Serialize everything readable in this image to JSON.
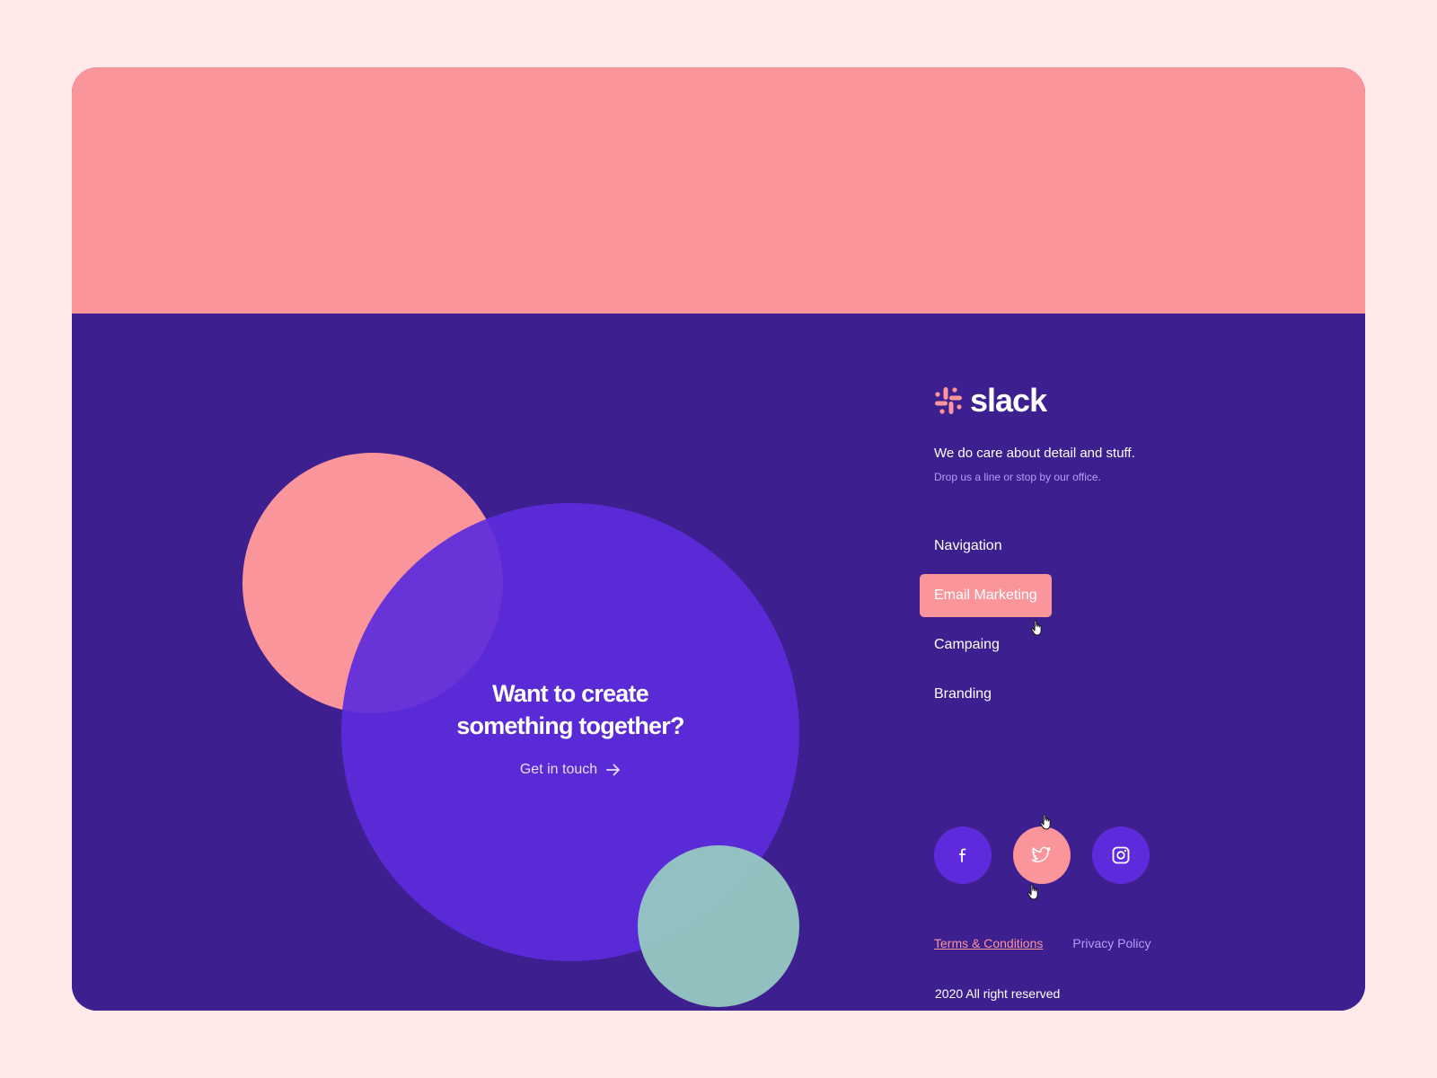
{
  "brand": {
    "name": "slack",
    "logo_color": "#fa959b"
  },
  "colors": {
    "page_bg": "#ffe9e9",
    "banner": "#fa959b",
    "footer_bg": "#3d1f8f",
    "accent_purple": "#5d2bdc",
    "accent_pink": "#fa959b",
    "accent_teal": "#98ccc2",
    "muted_text": "#b79cf4"
  },
  "cta": {
    "title_line1": "Want to create",
    "title_line2": "something together?",
    "link_label": "Get in touch",
    "link_icon": "arrow-right-icon"
  },
  "info": {
    "tagline": "We do care about detail and stuff.",
    "subline": "Drop us a line or stop by our office."
  },
  "nav": {
    "items": [
      {
        "label": "Navigation",
        "active": false
      },
      {
        "label": "Email Marketing",
        "active": true
      },
      {
        "label": "Campaing",
        "active": false
      },
      {
        "label": "Branding",
        "active": false
      }
    ]
  },
  "social": {
    "items": [
      {
        "icon": "facebook-icon",
        "active": false
      },
      {
        "icon": "twitter-icon",
        "active": true
      },
      {
        "icon": "instagram-icon",
        "active": false
      }
    ]
  },
  "legal": {
    "terms_label": "Terms & Conditions",
    "privacy_label": "Privacy Policy",
    "copyright": "2020 All right reserved"
  }
}
